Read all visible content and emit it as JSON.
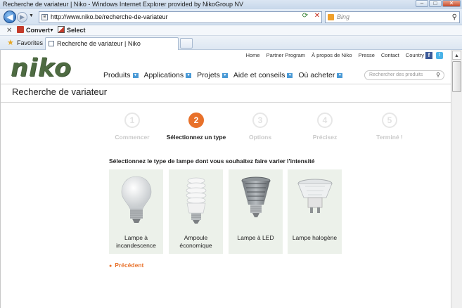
{
  "window": {
    "title": "Recherche de variateur | Niko - Windows Internet Explorer provided by NikoGroup NV",
    "url": "http://www.niko.be/recherche-de-variateur",
    "search_placeholder": "Bing"
  },
  "commandbar": {
    "convert": "Convert",
    "select": "Select"
  },
  "favorites": {
    "label": "Favorites",
    "tab_title": "Recherche de variateur | Niko"
  },
  "site": {
    "logo": "niko",
    "topnav": [
      "Home",
      "Partner Program",
      "À propos de Niko",
      "Presse",
      "Contact",
      "Country"
    ],
    "mainnav": [
      "Produits",
      "Applications",
      "Projets",
      "Aide et conseils",
      "Où acheter"
    ],
    "search_placeholder": "Rechercher des produits",
    "page_title": "Recherche de variateur"
  },
  "steps": [
    {
      "number": "1",
      "label": "Commencer"
    },
    {
      "number": "2",
      "label": "Sélectionnez un type"
    },
    {
      "number": "3",
      "label": "Options"
    },
    {
      "number": "4",
      "label": "Précisez"
    },
    {
      "number": "5",
      "label": "Terminé !"
    }
  ],
  "instruction": "Sélectionnez le type de lampe dont vous souhaitez faire varier l'intensité",
  "lamps": [
    {
      "line1": "Lampe à",
      "line2": "incandescence"
    },
    {
      "line1": "Ampoule",
      "line2": "économique"
    },
    {
      "line1": "Lampe à LED",
      "line2": ""
    },
    {
      "line1": "Lampe halogène",
      "line2": ""
    }
  ],
  "prev_link": "Précédent"
}
